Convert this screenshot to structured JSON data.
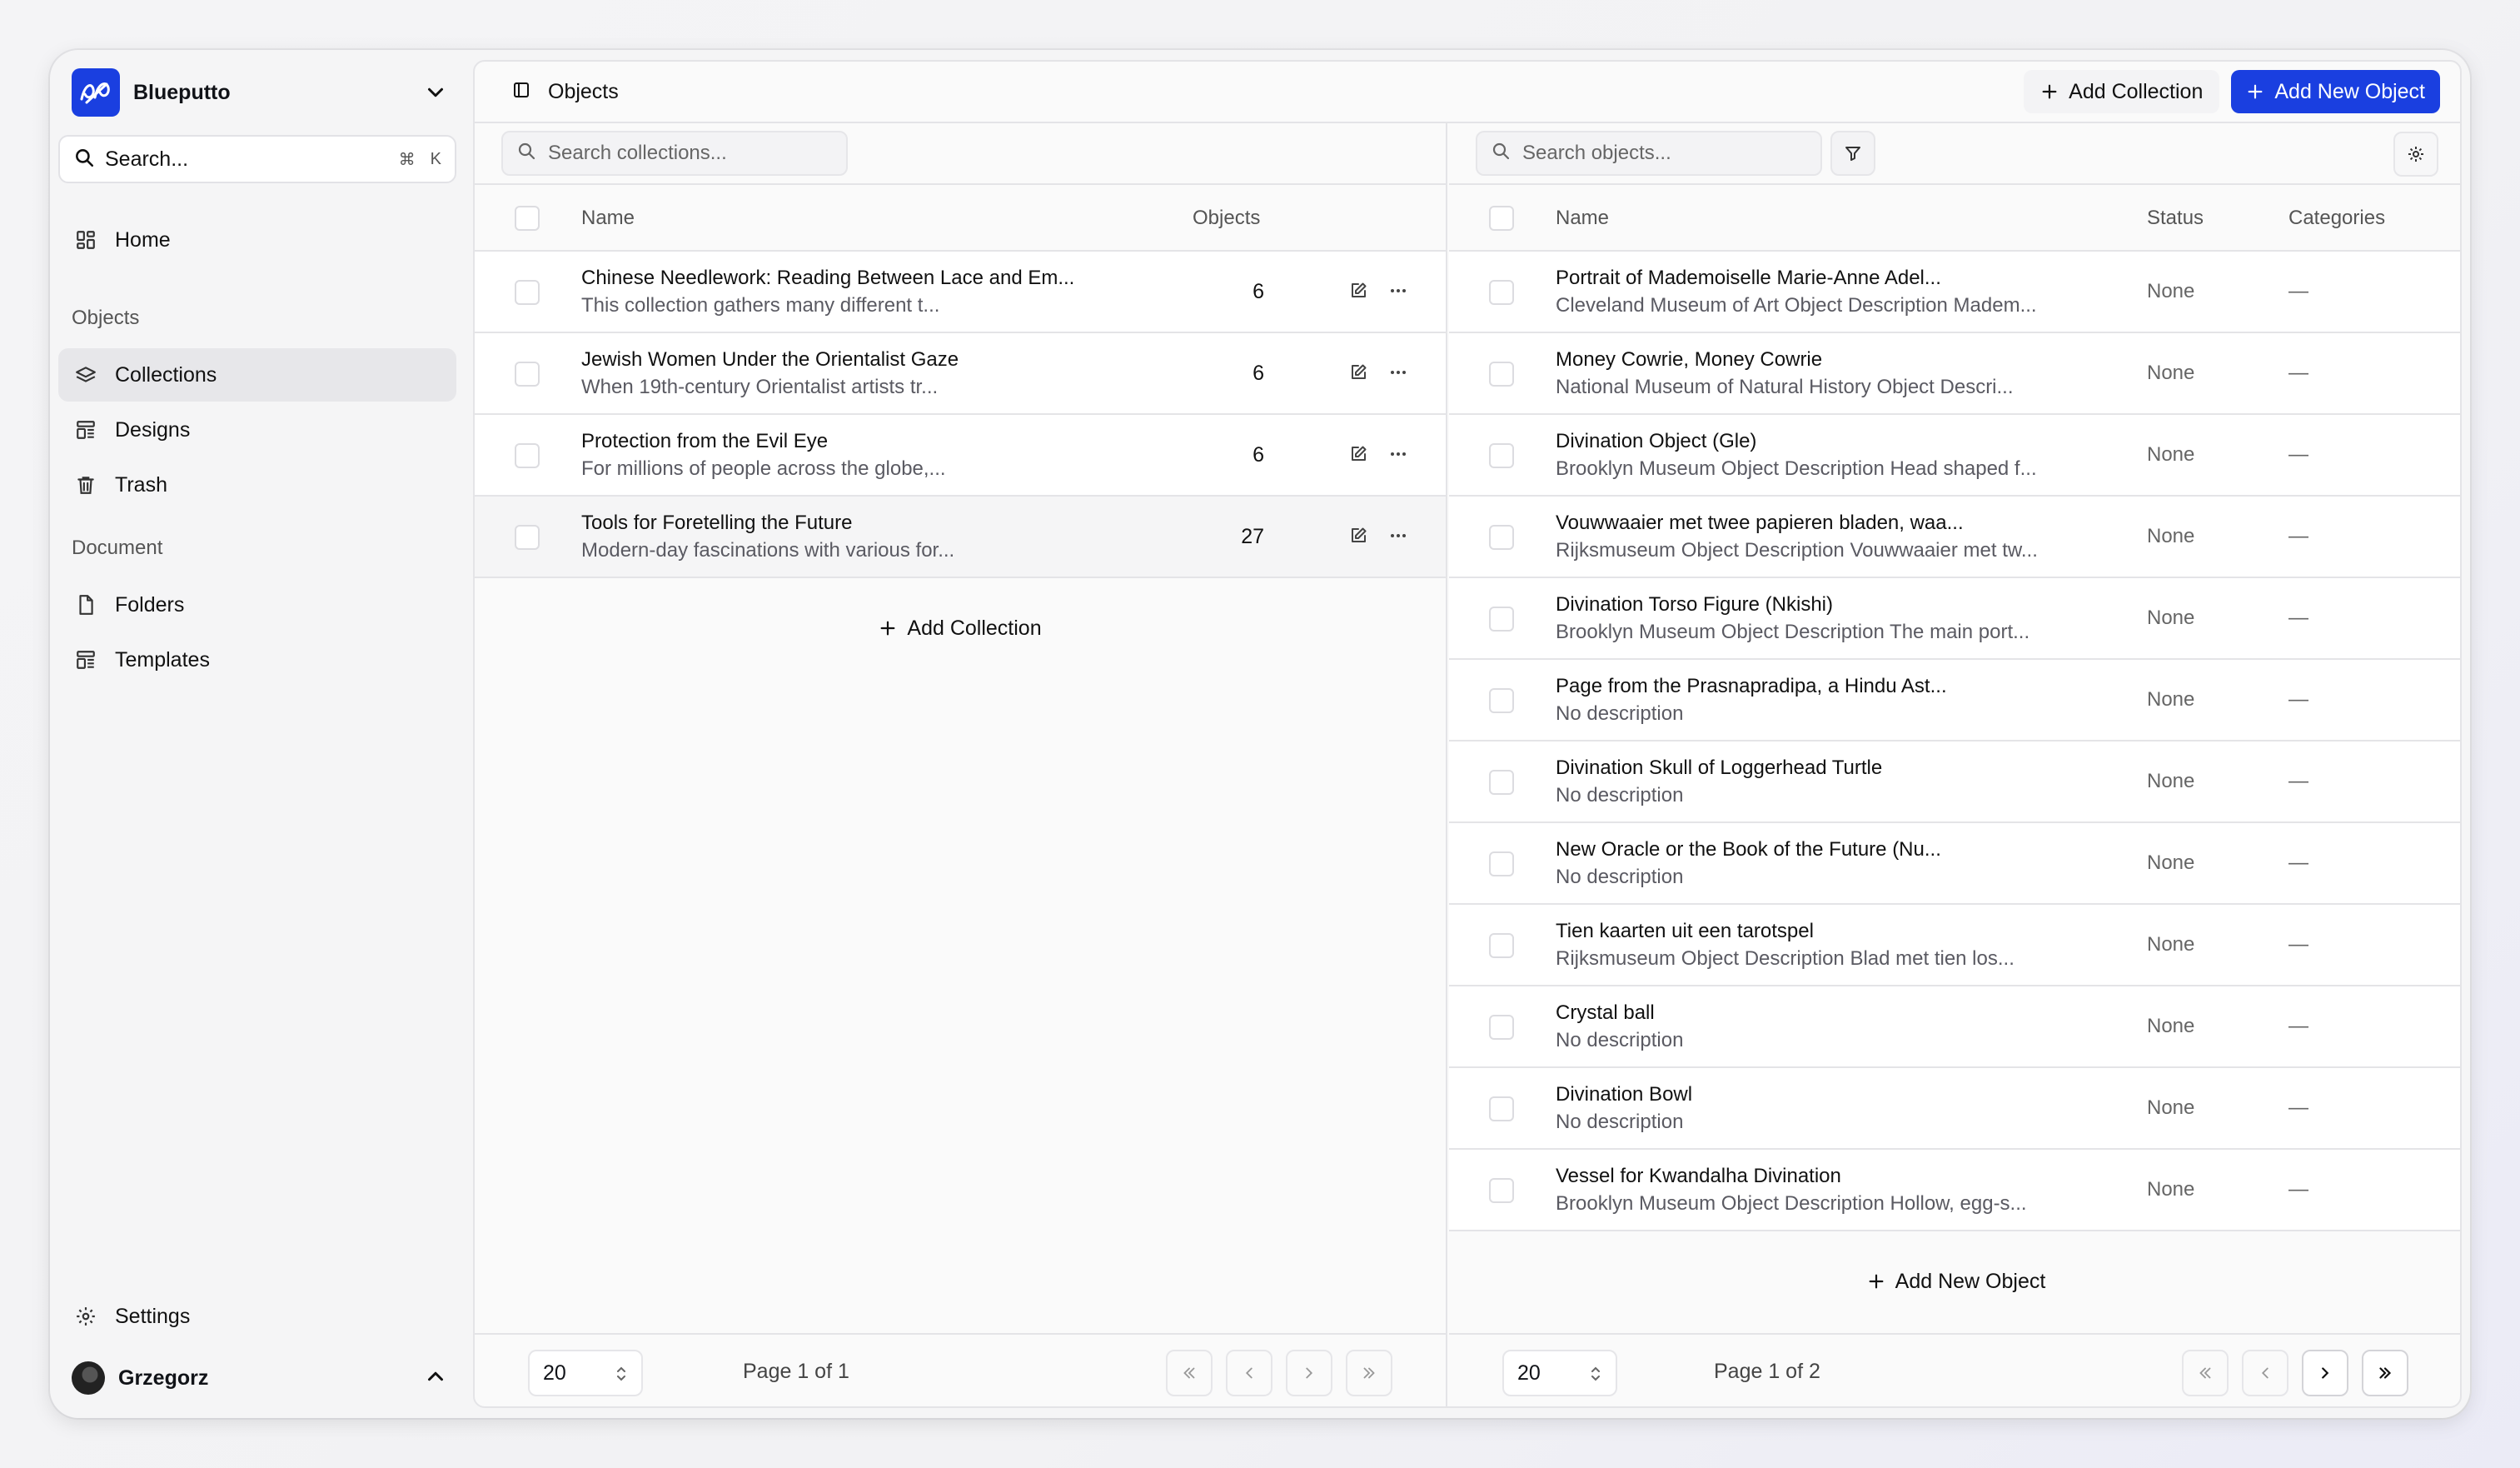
{
  "sidebar": {
    "workspace_name": "Blueputto",
    "search": {
      "placeholder": "Search...",
      "shortcut_cmd": "⌘",
      "shortcut_key": "K"
    },
    "home_label": "Home",
    "objects_section": "Objects",
    "collections_label": "Collections",
    "designs_label": "Designs",
    "trash_label": "Trash",
    "document_section": "Document",
    "folders_label": "Folders",
    "templates_label": "Templates",
    "settings_label": "Settings",
    "user_name": "Grzegorz"
  },
  "header": {
    "title": "Objects",
    "add_collection_label": "Add Collection",
    "add_object_label": "Add New Object"
  },
  "collections_panel": {
    "search_placeholder": "Search collections...",
    "columns": {
      "name": "Name",
      "objects": "Objects"
    },
    "rows": [
      {
        "title": "Chinese Needlework: Reading Between Lace and Em...",
        "subtitle": "This collection gathers many different t...",
        "count": "6"
      },
      {
        "title": "Jewish Women Under the Orientalist Gaze",
        "subtitle": "When 19th-century Orientalist artists tr...",
        "count": "6"
      },
      {
        "title": "Protection from the Evil Eye",
        "subtitle": "For millions of people across the globe,...",
        "count": "6"
      },
      {
        "title": "Tools for Foretelling the Future",
        "subtitle": "Modern-day fascinations with various for...",
        "count": "27"
      }
    ],
    "add_label": "Add Collection",
    "page_size": "20",
    "page_info": "Page 1 of 1"
  },
  "objects_panel": {
    "search_placeholder": "Search objects...",
    "columns": {
      "name": "Name",
      "status": "Status",
      "categories": "Categories"
    },
    "rows": [
      {
        "title": "Portrait of Mademoiselle Marie-Anne Adel...",
        "subtitle": "Cleveland Museum of Art Object Description Madem...",
        "status": "None",
        "categories": "—"
      },
      {
        "title": "Money Cowrie, Money Cowrie",
        "subtitle": "National Museum of Natural History Object Descri...",
        "status": "None",
        "categories": "—"
      },
      {
        "title": "Divination Object (Gle)",
        "subtitle": "Brooklyn Museum Object Description Head shaped f...",
        "status": "None",
        "categories": "—"
      },
      {
        "title": "Vouwwaaier met twee papieren bladen, waa...",
        "subtitle": "Rijksmuseum Object Description Vouwwaaier met tw...",
        "status": "None",
        "categories": "—"
      },
      {
        "title": "Divination Torso Figure (Nkishi)",
        "subtitle": "Brooklyn Museum Object Description The main port...",
        "status": "None",
        "categories": "—"
      },
      {
        "title": "Page from the Prasnapradipa, a Hindu Ast...",
        "subtitle": "No description",
        "status": "None",
        "categories": "—"
      },
      {
        "title": "Divination Skull of Loggerhead Turtle",
        "subtitle": "No description",
        "status": "None",
        "categories": "—"
      },
      {
        "title": "New Oracle or the Book of the Future (Nu...",
        "subtitle": "No description",
        "status": "None",
        "categories": "—"
      },
      {
        "title": "Tien kaarten uit een tarotspel",
        "subtitle": "Rijksmuseum Object Description Blad met tien los...",
        "status": "None",
        "categories": "—"
      },
      {
        "title": "Crystal ball",
        "subtitle": "No description",
        "status": "None",
        "categories": "—"
      },
      {
        "title": "Divination Bowl",
        "subtitle": "No description",
        "status": "None",
        "categories": "—"
      },
      {
        "title": "Vessel for Kwandalha Divination",
        "subtitle": "Brooklyn Museum Object Description Hollow, egg-s...",
        "status": "None",
        "categories": "—"
      }
    ],
    "add_label": "Add New Object",
    "page_size": "20",
    "page_info": "Page 1 of 2"
  },
  "colors": {
    "accent": "#1a3fe0",
    "sidebar_active": "#e7e7ea"
  },
  "icons": [
    "logo-icon",
    "chevron-down-icon",
    "search-icon",
    "home-icon",
    "layers-icon",
    "designs-icon",
    "trash-icon",
    "file-icon",
    "templates-icon",
    "gear-icon",
    "chevron-up-icon",
    "sidebar-toggle-icon",
    "plus-icon",
    "filter-icon",
    "edit-icon",
    "more-icon",
    "first-page-icon",
    "prev-page-icon",
    "next-page-icon",
    "last-page-icon"
  ]
}
